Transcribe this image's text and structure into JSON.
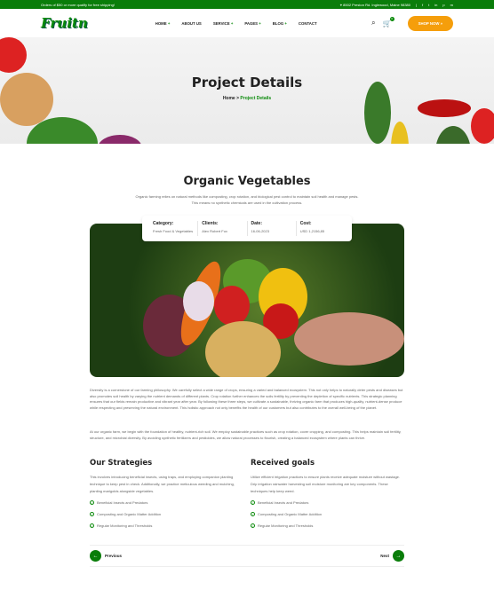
{
  "topbar": {
    "promo": "Orders of $50 or more qualify for free shipping!",
    "address": "8502 Preston Rd. Inglewood, Maine 98380",
    "social": [
      "f",
      "t",
      "in",
      "p",
      "m"
    ]
  },
  "header": {
    "logo": "Fruitn",
    "nav": [
      "HOME",
      "ABOUT US",
      "SERVICE",
      "PAGES",
      "BLOG",
      "CONTACT"
    ],
    "shop_now": "SHOP NOW »",
    "cart_count": "0"
  },
  "hero": {
    "title": "Project Details",
    "crumb_home": "Home",
    "crumb_sep": ">",
    "crumb_current": "Project Details"
  },
  "project": {
    "title": "Organic Vegetables",
    "intro": "Organic farming relies on natural methods like composting, crop rotation, and biological pest control to maintain soil health and manage pests. This means no synthetic chemicals are used in the cultivation process.",
    "info": [
      {
        "label": "Category:",
        "value": "Fresh Food & Vegetables"
      },
      {
        "label": "Clients:",
        "value": "Alex Robert Fox"
      },
      {
        "label": "Date:",
        "value": "16-06-2023"
      },
      {
        "label": "Cost:",
        "value": "USD 1,2156,85"
      }
    ],
    "para1": "Diversity is a cornerstone of our farming philosophy. We carefully select a wide range of crops, ensuring a varied and balanced ecosystem. This not only helps to naturally deter pests and diseases but also promotes soil health by varying the nutrient demands of different plants. Crop rotation further enhances the soils fertility by preventing the depletion of specific nutrients. This strategic planning ensures that our fields remain productive and vibrant year after year. By following these three steps, we cultivate a sustainable, thriving organic farm that produces high-quality, nutrient-dense produce while respecting and preserving the natural environment. This holistic approach not only benefits the health of our customers but also contributes to the overall well-being of the planet.",
    "para2": "At our organic farm, we begin with the foundation of healthy, nutrient-rich soil. We employ sustainable practices such as crop rotation, cover cropping, and composting. This helps maintain soil fertility, structure, and microbial diversity. By avoiding synthetic fertilizers and pesticides, we allow natural processes to flourish, creating a balanced ecosystem where plants can thrive."
  },
  "strategies": {
    "title": "Our Strategies",
    "text": "This involves introducing beneficial insects, using traps, and employing companion planting technique to keep pest in check. Additionally, we practice meticulous weeding and mulching, planting marigolds alongside vegetables.",
    "items": [
      "Beneficial Insects and Predators",
      "Composting and Organic Matter Addition",
      "Regular Monitoring and Thresholds"
    ]
  },
  "goals": {
    "title": "Received goals",
    "text": "Utilize efficient irrigation practices to ensure plants receive adequate moisture without wastage. Drip irrigation rainwater harvesting soil moisture monitoring are key components. These techniques help keep weed.",
    "items": [
      "Beneficial Insects and Predators",
      "Composting and Organic Matter Addition",
      "Regular Monitoring and Thresholds"
    ]
  },
  "pager": {
    "prev": "Previous",
    "next": "Next"
  }
}
